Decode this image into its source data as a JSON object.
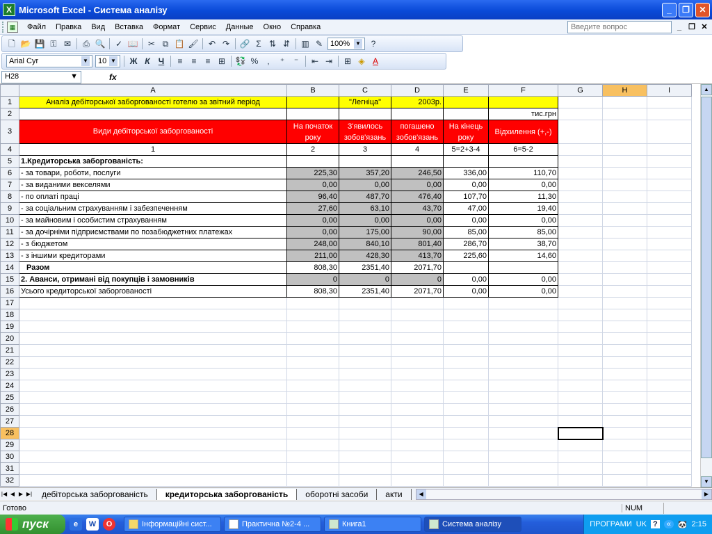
{
  "window": {
    "title": "Microsoft Excel - Система аналізу"
  },
  "menu": [
    "Файл",
    "Правка",
    "Вид",
    "Вставка",
    "Формат",
    "Сервис",
    "Данные",
    "Окно",
    "Справка"
  ],
  "help_placeholder": "Введите вопрос",
  "toolbar": {
    "zoom": "100%"
  },
  "format_toolbar": {
    "font": "Arial Cyr",
    "size": "10",
    "bold": "Ж",
    "italic": "К",
    "underline": "Ч"
  },
  "formula_bar": {
    "cell_ref": "H28",
    "fx": "fx",
    "content": ""
  },
  "columns": [
    "A",
    "B",
    "C",
    "D",
    "E",
    "F",
    "G",
    "H",
    "I"
  ],
  "sheet": {
    "r1": {
      "a": "Аналіз дебіторської заборгованості готелю за звітний період",
      "c": "\"Легніца\"",
      "d": "2003р."
    },
    "r2": {
      "f": "тис.грн"
    },
    "r3": {
      "a": "Види дебіторської заборгованості",
      "b": "На початок року",
      "c": "З'явилось зобов'язань",
      "d": "погашено зобов'язань",
      "e": "На кінець року",
      "f": "Відхилення (+,-)"
    },
    "r4": {
      "a": "1",
      "b": "2",
      "c": "3",
      "d": "4",
      "e": "5=2+3-4",
      "f": "6=5-2"
    },
    "r5": {
      "a": "1.Кредиторська заборгованість:"
    },
    "data": [
      {
        "a": " - за товари, роботи, послуги",
        "b": "225,30",
        "c": "357,20",
        "d": "246,50",
        "e": "336,00",
        "f": "110,70"
      },
      {
        "a": " - за виданими векселями",
        "b": "0,00",
        "c": "0,00",
        "d": "0,00",
        "e": "0,00",
        "f": "0,00"
      },
      {
        "a": " - по оплаті праці",
        "b": "96,40",
        "c": "487,70",
        "d": "476,40",
        "e": "107,70",
        "f": "11,30"
      },
      {
        "a": " - за соціальним страхуванням і забезпеченням",
        "b": "27,60",
        "c": "63,10",
        "d": "43,70",
        "e": "47,00",
        "f": "19,40"
      },
      {
        "a": " - за майновим і особистим страхуванням",
        "b": "0,00",
        "c": "0,00",
        "d": "0,00",
        "e": "0,00",
        "f": "0,00"
      },
      {
        "a": " - за дочірніми підприємствами по позабюджетних платежах",
        "b": "0,00",
        "c": "175,00",
        "d": "90,00",
        "e": "85,00",
        "f": "85,00"
      },
      {
        "a": " - з бюджетом",
        "b": "248,00",
        "c": "840,10",
        "d": "801,40",
        "e": "286,70",
        "f": "38,70"
      },
      {
        "a": " - з іншими кредиторами",
        "b": "211,00",
        "c": "428,30",
        "d": "413,70",
        "e": "225,60",
        "f": "14,60"
      }
    ],
    "r14": {
      "a": "Разом",
      "b": "808,30",
      "c": "2351,40",
      "d": "2071,70"
    },
    "r15": {
      "a": "2. Аванси, отримані від покупців і замовників",
      "b": "0",
      "c": "0",
      "d": "0",
      "e": "0,00",
      "f": "0,00"
    },
    "r16": {
      "a": "Усього кредиторської заборгованості",
      "b": "808,30",
      "c": "2351,40",
      "d": "2071,70",
      "e": "0,00",
      "f": "0,00"
    }
  },
  "sheet_tabs": [
    "дебіторська заборгованість",
    "кредиторська заборгованість",
    "оборотні засоби",
    "акти"
  ],
  "active_tab": "кредиторська заборгованість",
  "status": {
    "ready": "Готово",
    "num": "NUM"
  },
  "taskbar": {
    "start": "пуск",
    "tasks": [
      "Інформаційні сист...",
      "Практична №2-4 ...",
      "Книга1",
      "Система аналізу"
    ],
    "tray_label": "ПРОГРАМИ",
    "lang": "UK",
    "clock": "2:15"
  }
}
